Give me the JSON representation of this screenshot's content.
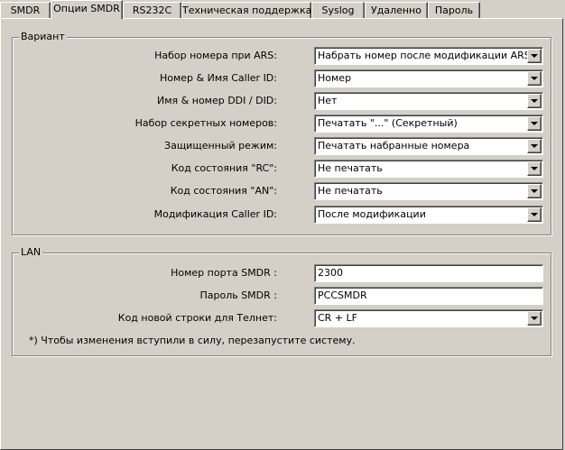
{
  "tabs": [
    {
      "label": "SMDR",
      "active": false
    },
    {
      "label": "Опции SMDR",
      "active": true
    },
    {
      "label": "RS232C",
      "active": false
    },
    {
      "label": "Техническая поддержка",
      "active": false
    },
    {
      "label": "Syslog",
      "active": false
    },
    {
      "label": "Удаленно",
      "active": false
    },
    {
      "label": "Пароль",
      "active": false
    }
  ],
  "variant": {
    "title": "Вариант",
    "rows": [
      {
        "label": "Набор номера при ARS:",
        "value": "Набрать номер после модификации ARS"
      },
      {
        "label": "Номер & Имя Caller ID:",
        "value": "Номер"
      },
      {
        "label": "Имя & номер DDI / DID:",
        "value": "Нет"
      },
      {
        "label": "Набор секретных номеров:",
        "value": "Печатать \"...\" (Секретный)"
      },
      {
        "label": "Защищенный режим:",
        "value": "Печатать набранные номера"
      },
      {
        "label": "Код состояния \"RC\":",
        "value": "Не печатать"
      },
      {
        "label": "Код состояния \"AN\":",
        "value": "Не печатать"
      },
      {
        "label": "Модификация Caller ID:",
        "value": "После модификации"
      }
    ]
  },
  "lan": {
    "title": "LAN",
    "port": {
      "label": "Номер порта SMDR :",
      "value": "2300"
    },
    "password": {
      "label": "Пароль SMDR :",
      "value": "PCCSMDR"
    },
    "newline": {
      "label": "Код новой строки для Телнет:",
      "value": "CR + LF"
    },
    "note": "*) Чтобы изменения вступили в силу, перезапустите систему."
  },
  "icons": {
    "dropdown": "chevron-down-icon"
  },
  "colors": {
    "face": "#d4d0c8",
    "highlight": "#ffffff",
    "shadow": "#808080",
    "dark_shadow": "#404040"
  }
}
